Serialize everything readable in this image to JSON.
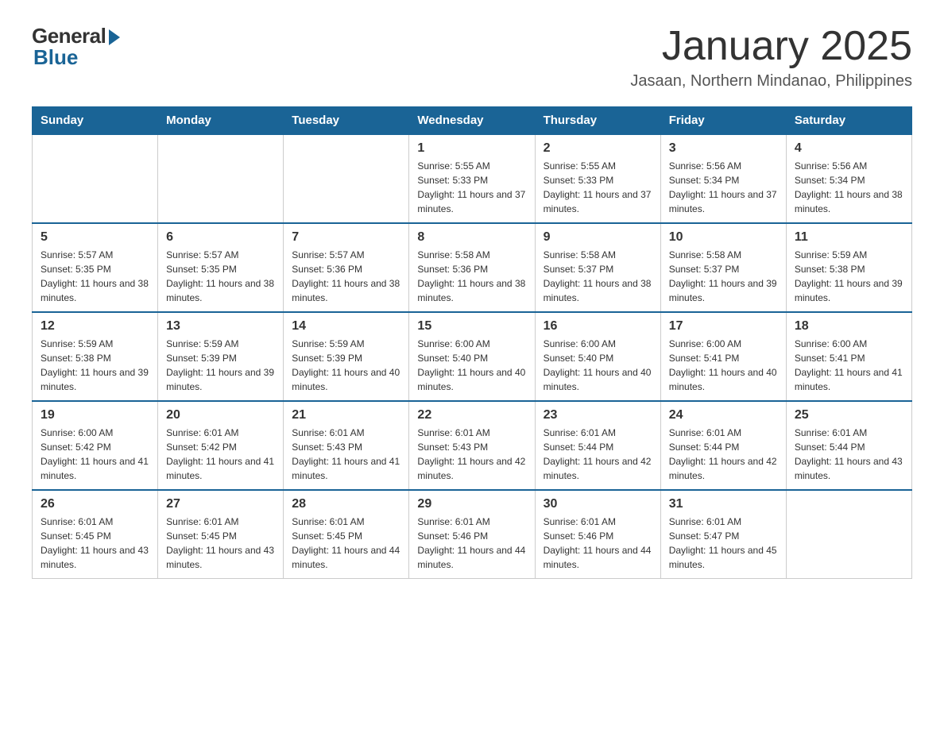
{
  "logo": {
    "general": "General",
    "blue": "Blue"
  },
  "title": "January 2025",
  "location": "Jasaan, Northern Mindanao, Philippines",
  "days_of_week": [
    "Sunday",
    "Monday",
    "Tuesday",
    "Wednesday",
    "Thursday",
    "Friday",
    "Saturday"
  ],
  "weeks": [
    [
      {
        "day": "",
        "info": ""
      },
      {
        "day": "",
        "info": ""
      },
      {
        "day": "",
        "info": ""
      },
      {
        "day": "1",
        "info": "Sunrise: 5:55 AM\nSunset: 5:33 PM\nDaylight: 11 hours and 37 minutes."
      },
      {
        "day": "2",
        "info": "Sunrise: 5:55 AM\nSunset: 5:33 PM\nDaylight: 11 hours and 37 minutes."
      },
      {
        "day": "3",
        "info": "Sunrise: 5:56 AM\nSunset: 5:34 PM\nDaylight: 11 hours and 37 minutes."
      },
      {
        "day": "4",
        "info": "Sunrise: 5:56 AM\nSunset: 5:34 PM\nDaylight: 11 hours and 38 minutes."
      }
    ],
    [
      {
        "day": "5",
        "info": "Sunrise: 5:57 AM\nSunset: 5:35 PM\nDaylight: 11 hours and 38 minutes."
      },
      {
        "day": "6",
        "info": "Sunrise: 5:57 AM\nSunset: 5:35 PM\nDaylight: 11 hours and 38 minutes."
      },
      {
        "day": "7",
        "info": "Sunrise: 5:57 AM\nSunset: 5:36 PM\nDaylight: 11 hours and 38 minutes."
      },
      {
        "day": "8",
        "info": "Sunrise: 5:58 AM\nSunset: 5:36 PM\nDaylight: 11 hours and 38 minutes."
      },
      {
        "day": "9",
        "info": "Sunrise: 5:58 AM\nSunset: 5:37 PM\nDaylight: 11 hours and 38 minutes."
      },
      {
        "day": "10",
        "info": "Sunrise: 5:58 AM\nSunset: 5:37 PM\nDaylight: 11 hours and 39 minutes."
      },
      {
        "day": "11",
        "info": "Sunrise: 5:59 AM\nSunset: 5:38 PM\nDaylight: 11 hours and 39 minutes."
      }
    ],
    [
      {
        "day": "12",
        "info": "Sunrise: 5:59 AM\nSunset: 5:38 PM\nDaylight: 11 hours and 39 minutes."
      },
      {
        "day": "13",
        "info": "Sunrise: 5:59 AM\nSunset: 5:39 PM\nDaylight: 11 hours and 39 minutes."
      },
      {
        "day": "14",
        "info": "Sunrise: 5:59 AM\nSunset: 5:39 PM\nDaylight: 11 hours and 40 minutes."
      },
      {
        "day": "15",
        "info": "Sunrise: 6:00 AM\nSunset: 5:40 PM\nDaylight: 11 hours and 40 minutes."
      },
      {
        "day": "16",
        "info": "Sunrise: 6:00 AM\nSunset: 5:40 PM\nDaylight: 11 hours and 40 minutes."
      },
      {
        "day": "17",
        "info": "Sunrise: 6:00 AM\nSunset: 5:41 PM\nDaylight: 11 hours and 40 minutes."
      },
      {
        "day": "18",
        "info": "Sunrise: 6:00 AM\nSunset: 5:41 PM\nDaylight: 11 hours and 41 minutes."
      }
    ],
    [
      {
        "day": "19",
        "info": "Sunrise: 6:00 AM\nSunset: 5:42 PM\nDaylight: 11 hours and 41 minutes."
      },
      {
        "day": "20",
        "info": "Sunrise: 6:01 AM\nSunset: 5:42 PM\nDaylight: 11 hours and 41 minutes."
      },
      {
        "day": "21",
        "info": "Sunrise: 6:01 AM\nSunset: 5:43 PM\nDaylight: 11 hours and 41 minutes."
      },
      {
        "day": "22",
        "info": "Sunrise: 6:01 AM\nSunset: 5:43 PM\nDaylight: 11 hours and 42 minutes."
      },
      {
        "day": "23",
        "info": "Sunrise: 6:01 AM\nSunset: 5:44 PM\nDaylight: 11 hours and 42 minutes."
      },
      {
        "day": "24",
        "info": "Sunrise: 6:01 AM\nSunset: 5:44 PM\nDaylight: 11 hours and 42 minutes."
      },
      {
        "day": "25",
        "info": "Sunrise: 6:01 AM\nSunset: 5:44 PM\nDaylight: 11 hours and 43 minutes."
      }
    ],
    [
      {
        "day": "26",
        "info": "Sunrise: 6:01 AM\nSunset: 5:45 PM\nDaylight: 11 hours and 43 minutes."
      },
      {
        "day": "27",
        "info": "Sunrise: 6:01 AM\nSunset: 5:45 PM\nDaylight: 11 hours and 43 minutes."
      },
      {
        "day": "28",
        "info": "Sunrise: 6:01 AM\nSunset: 5:45 PM\nDaylight: 11 hours and 44 minutes."
      },
      {
        "day": "29",
        "info": "Sunrise: 6:01 AM\nSunset: 5:46 PM\nDaylight: 11 hours and 44 minutes."
      },
      {
        "day": "30",
        "info": "Sunrise: 6:01 AM\nSunset: 5:46 PM\nDaylight: 11 hours and 44 minutes."
      },
      {
        "day": "31",
        "info": "Sunrise: 6:01 AM\nSunset: 5:47 PM\nDaylight: 11 hours and 45 minutes."
      },
      {
        "day": "",
        "info": ""
      }
    ]
  ]
}
